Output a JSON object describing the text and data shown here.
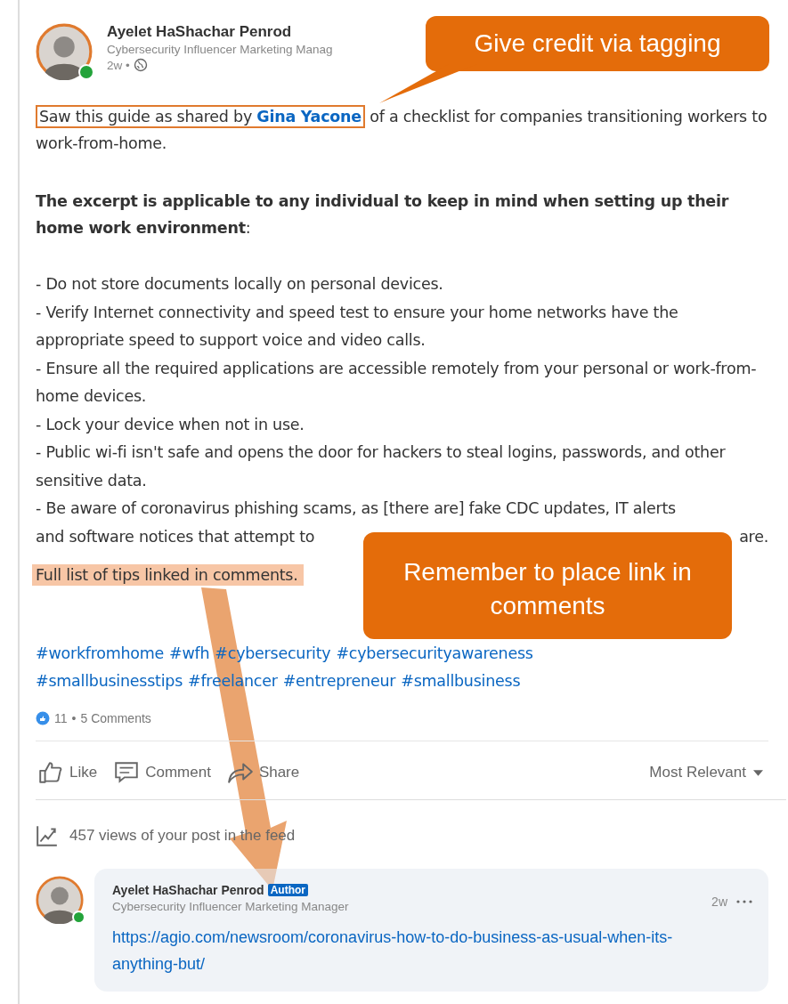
{
  "post": {
    "author": {
      "name": "Ayelet HaShachar Penrod",
      "headline": "Cybersecurity Influencer Marketing Manag",
      "online": true,
      "time": "2w •"
    },
    "intro": {
      "framed": "Saw this guide as shared by ",
      "mention": "Gina Yacone",
      "after": " of a checklist for companies transitioning workers to work-from-home."
    },
    "emphasis": "**The excerpt is applicable to any individual to keep in mind when setting up their home work environment**:",
    "bullets": [
      {
        "text": "- Do not store documents locally on personal devices."
      },
      {
        "text": "- Verify Internet connectivity and speed test to ensure your home networks have the appropriate speed to support voice and video calls."
      },
      {
        "text": "- Ensure all the required applications are accessible remotely from your personal or work-from-home devices."
      },
      {
        "text": "- Lock your device when not in use."
      },
      {
        "text": "- Public wi-fi isn't safe and opens the door for hackers to steal logins, passwords, and other sensitive data."
      },
      {
        "text": "- Be aware of coronavirus phishing scams, as [there are] fake CDC updates, IT alerts",
        "second_line": "and software notices that attempt to",
        "tail": "are."
      }
    ],
    "note": "Full list of tips linked in comments.",
    "hashtag_lines": [
      [
        "#workfromhome",
        "#wfh",
        "#cybersecurity",
        "#cybersecurityawareness"
      ],
      [
        "#smallbusinesstips",
        "#freelancer",
        "#entrepreneur",
        "#smallbusiness"
      ]
    ],
    "reactions": {
      "count": "11",
      "separator": "•",
      "comments": "5 Comments"
    },
    "actions": [
      {
        "kind": "like",
        "label": "Like"
      },
      {
        "kind": "comment",
        "label": "Comment"
      },
      {
        "kind": "share",
        "label": "Share"
      }
    ],
    "sort": "Most Relevant",
    "views": "457 views of your post in the feed",
    "comment": {
      "name": "Ayelet HaShachar Penrod",
      "badge": "Author",
      "headline": "Cybersecurity Influencer Marketing Manager",
      "time": "2w",
      "online": true,
      "link": "https://agio.com/newsroom/coronavirus-how-to-do-business-as-usual-when-its-anything-but/"
    }
  },
  "annotations": [
    {
      "kind": "callout",
      "text": "Give credit via tagging"
    },
    {
      "kind": "callout",
      "text": "Remember to place link in comments"
    },
    {
      "kind": "arrow"
    }
  ]
}
